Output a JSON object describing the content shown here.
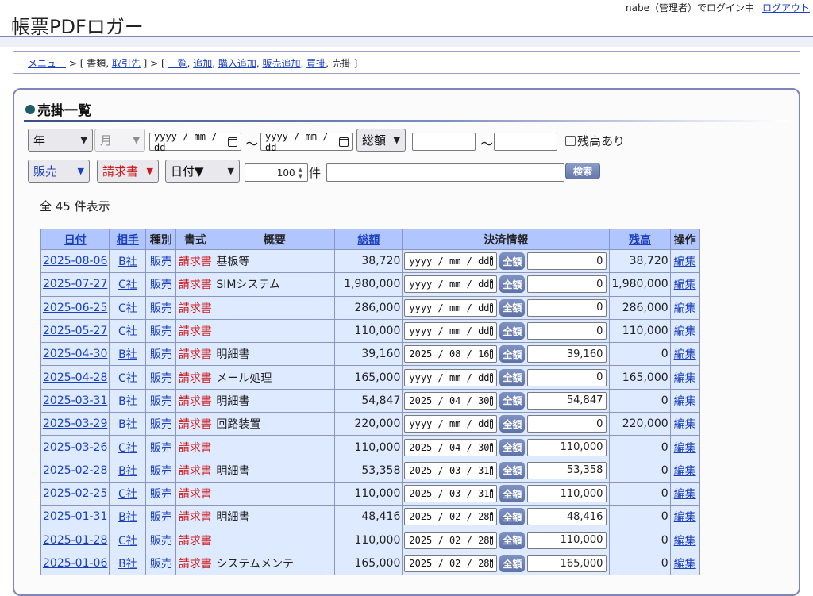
{
  "header": {
    "title": "帳票PDFロガー",
    "login_text": "nabe（管理者）でログイン中",
    "logout_label": "ログアウト"
  },
  "breadcrumb": {
    "menu": "メニュー",
    "sep1": " > [ 書類, ",
    "partners": "取引先",
    "sep2": " ] > [ ",
    "list": "一覧",
    "add": "追加",
    "purchase_add": "購入追加",
    "sales_add": "販売追加",
    "payable": "買掛",
    "current": "売掛",
    "close": " ]"
  },
  "section_title": "売掛一覧",
  "filters": {
    "year": "年",
    "month": "月",
    "date_from_placeholder": "yyyy / mm / dd",
    "date_to_placeholder": "yyyy / mm / dd",
    "tilde": "～",
    "amount_type": "総額",
    "balance_only_label": "残高あり",
    "trade_type": "販売",
    "doc_type": "請求書",
    "sort": "日付▼",
    "per_page": "100",
    "per_page_unit": "件",
    "search_label": "検索"
  },
  "count_text": "全 45 件表示",
  "table": {
    "headers": {
      "date": "日付",
      "partner": "相手",
      "kind": "種別",
      "format": "書式",
      "summary": "概要",
      "total": "総額",
      "settlement": "決済情報",
      "balance": "残高",
      "action": "操作"
    },
    "pay_all_label": "全額",
    "edit_label": "編集",
    "rows": [
      {
        "date": "2025-08-06",
        "partner": "B社",
        "kind": "販売",
        "format": "請求書",
        "summary": "基板等",
        "total": "38,720",
        "paid_date": "yyyy / mm / dd",
        "paid_amount": "0",
        "balance": "38,720"
      },
      {
        "date": "2025-07-27",
        "partner": "C社",
        "kind": "販売",
        "format": "請求書",
        "summary": "SIMシステム",
        "total": "1,980,000",
        "paid_date": "yyyy / mm / dd",
        "paid_amount": "0",
        "balance": "1,980,000"
      },
      {
        "date": "2025-06-25",
        "partner": "C社",
        "kind": "販売",
        "format": "請求書",
        "summary": "",
        "total": "286,000",
        "paid_date": "yyyy / mm / dd",
        "paid_amount": "0",
        "balance": "286,000"
      },
      {
        "date": "2025-05-27",
        "partner": "C社",
        "kind": "販売",
        "format": "請求書",
        "summary": "",
        "total": "110,000",
        "paid_date": "yyyy / mm / dd",
        "paid_amount": "0",
        "balance": "110,000"
      },
      {
        "date": "2025-04-30",
        "partner": "B社",
        "kind": "販売",
        "format": "請求書",
        "summary": "明細書",
        "total": "39,160",
        "paid_date": "2025 / 08 / 16",
        "paid_amount": "39,160",
        "balance": "0"
      },
      {
        "date": "2025-04-28",
        "partner": "C社",
        "kind": "販売",
        "format": "請求書",
        "summary": "メール処理",
        "total": "165,000",
        "paid_date": "yyyy / mm / dd",
        "paid_amount": "0",
        "balance": "165,000"
      },
      {
        "date": "2025-03-31",
        "partner": "B社",
        "kind": "販売",
        "format": "請求書",
        "summary": "明細書",
        "total": "54,847",
        "paid_date": "2025 / 04 / 30",
        "paid_amount": "54,847",
        "balance": "0"
      },
      {
        "date": "2025-03-29",
        "partner": "B社",
        "kind": "販売",
        "format": "請求書",
        "summary": "回路装置",
        "total": "220,000",
        "paid_date": "yyyy / mm / dd",
        "paid_amount": "0",
        "balance": "220,000"
      },
      {
        "date": "2025-03-26",
        "partner": "C社",
        "kind": "販売",
        "format": "請求書",
        "summary": "",
        "total": "110,000",
        "paid_date": "2025 / 04 / 30",
        "paid_amount": "110,000",
        "balance": "0"
      },
      {
        "date": "2025-02-28",
        "partner": "B社",
        "kind": "販売",
        "format": "請求書",
        "summary": "明細書",
        "total": "53,358",
        "paid_date": "2025 / 03 / 31",
        "paid_amount": "53,358",
        "balance": "0"
      },
      {
        "date": "2025-02-25",
        "partner": "C社",
        "kind": "販売",
        "format": "請求書",
        "summary": "",
        "total": "110,000",
        "paid_date": "2025 / 03 / 31",
        "paid_amount": "110,000",
        "balance": "0"
      },
      {
        "date": "2025-01-31",
        "partner": "B社",
        "kind": "販売",
        "format": "請求書",
        "summary": "明細書",
        "total": "48,416",
        "paid_date": "2025 / 02 / 28",
        "paid_amount": "48,416",
        "balance": "0"
      },
      {
        "date": "2025-01-28",
        "partner": "C社",
        "kind": "販売",
        "format": "請求書",
        "summary": "",
        "total": "110,000",
        "paid_date": "2025 / 02 / 28",
        "paid_amount": "110,000",
        "balance": "0"
      },
      {
        "date": "2025-01-06",
        "partner": "B社",
        "kind": "販売",
        "format": "請求書",
        "summary": "システムメンテ",
        "total": "165,000",
        "paid_date": "2025 / 02 / 28",
        "paid_amount": "165,000",
        "balance": "0"
      }
    ]
  }
}
